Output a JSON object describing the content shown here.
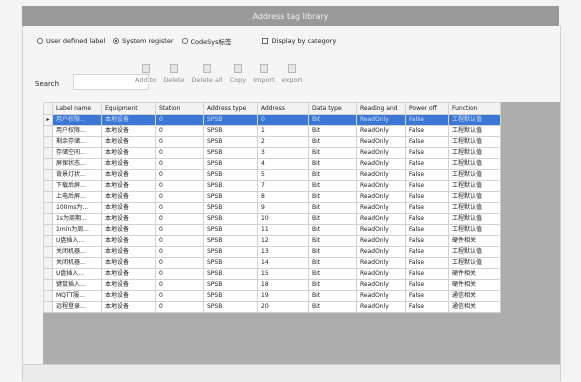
{
  "window": {
    "title": "Address tag library"
  },
  "options": {
    "radio_user": "User defined label",
    "radio_system": "System register",
    "radio_codesys": "CodeSys标签",
    "checkbox_display": "Display by category"
  },
  "search": {
    "label": "Search",
    "value": ""
  },
  "toolbar": [
    "Add to",
    "Delete",
    "Delete all",
    "Copy",
    "Import",
    "export"
  ],
  "table": {
    "columns": [
      "Label name",
      "Equipment",
      "Station",
      "Address type",
      "Address",
      "Data type",
      "Reading and",
      "Power off",
      "Function"
    ],
    "selected_row": 0,
    "rows": [
      [
        "用户权限...",
        "本地设备",
        "0",
        "SPSB",
        "0",
        "Bit",
        "ReadOnly",
        "False",
        "工程默认值"
      ],
      [
        "用户权限...",
        "本地设备",
        "0",
        "SPSB",
        "1",
        "Bit",
        "ReadOnly",
        "False",
        "工程默认值"
      ],
      [
        "剩余存储...",
        "本地设备",
        "0",
        "SPSB",
        "2",
        "Bit",
        "ReadOnly",
        "False",
        "工程默认值"
      ],
      [
        "存储空间...",
        "本地设备",
        "0",
        "SPSB",
        "3",
        "Bit",
        "ReadOnly",
        "False",
        "工程默认值"
      ],
      [
        "屏保状态...",
        "本地设备",
        "0",
        "SPSB",
        "4",
        "Bit",
        "ReadOnly",
        "False",
        "工程默认值"
      ],
      [
        "背景灯状...",
        "本地设备",
        "0",
        "SPSB",
        "5",
        "Bit",
        "ReadOnly",
        "False",
        "工程默认值"
      ],
      [
        "下载后屏...",
        "本地设备",
        "0",
        "SPSB",
        "7",
        "Bit",
        "ReadOnly",
        "False",
        "工程默认值"
      ],
      [
        "上电后屏...",
        "本地设备",
        "0",
        "SPSB",
        "8",
        "Bit",
        "ReadOnly",
        "False",
        "工程默认值"
      ],
      [
        "100ms为...",
        "本地设备",
        "0",
        "SPSB",
        "9",
        "Bit",
        "ReadOnly",
        "False",
        "工程默认值"
      ],
      [
        "1s为周期...",
        "本地设备",
        "0",
        "SPSB",
        "10",
        "Bit",
        "ReadOnly",
        "False",
        "工程默认值"
      ],
      [
        "1min为周...",
        "本地设备",
        "0",
        "SPSB",
        "11",
        "Bit",
        "ReadOnly",
        "False",
        "工程默认值"
      ],
      [
        "U盘插入...",
        "本地设备",
        "0",
        "SPSB",
        "12",
        "Bit",
        "ReadOnly",
        "False",
        "硬件相关"
      ],
      [
        "关闭机器...",
        "本地设备",
        "0",
        "SPSB",
        "13",
        "Bit",
        "ReadOnly",
        "False",
        "工程默认值"
      ],
      [
        "关闭机器...",
        "本地设备",
        "0",
        "SPSB",
        "14",
        "Bit",
        "ReadOnly",
        "False",
        "工程默认值"
      ],
      [
        "U盘插入...",
        "本地设备",
        "0",
        "SPSB",
        "15",
        "Bit",
        "ReadOnly",
        "False",
        "硬件相关"
      ],
      [
        "键鼠插入...",
        "本地设备",
        "0",
        "SPSB",
        "18",
        "Bit",
        "ReadOnly",
        "False",
        "硬件相关"
      ],
      [
        "MQTT服...",
        "本地设备",
        "0",
        "SPSB",
        "19",
        "Bit",
        "ReadOnly",
        "False",
        "通信相关"
      ],
      [
        "远程登录...",
        "本地设备",
        "0",
        "SPSB",
        "20",
        "Bit",
        "ReadOnly",
        "False",
        "通信相关"
      ]
    ]
  }
}
